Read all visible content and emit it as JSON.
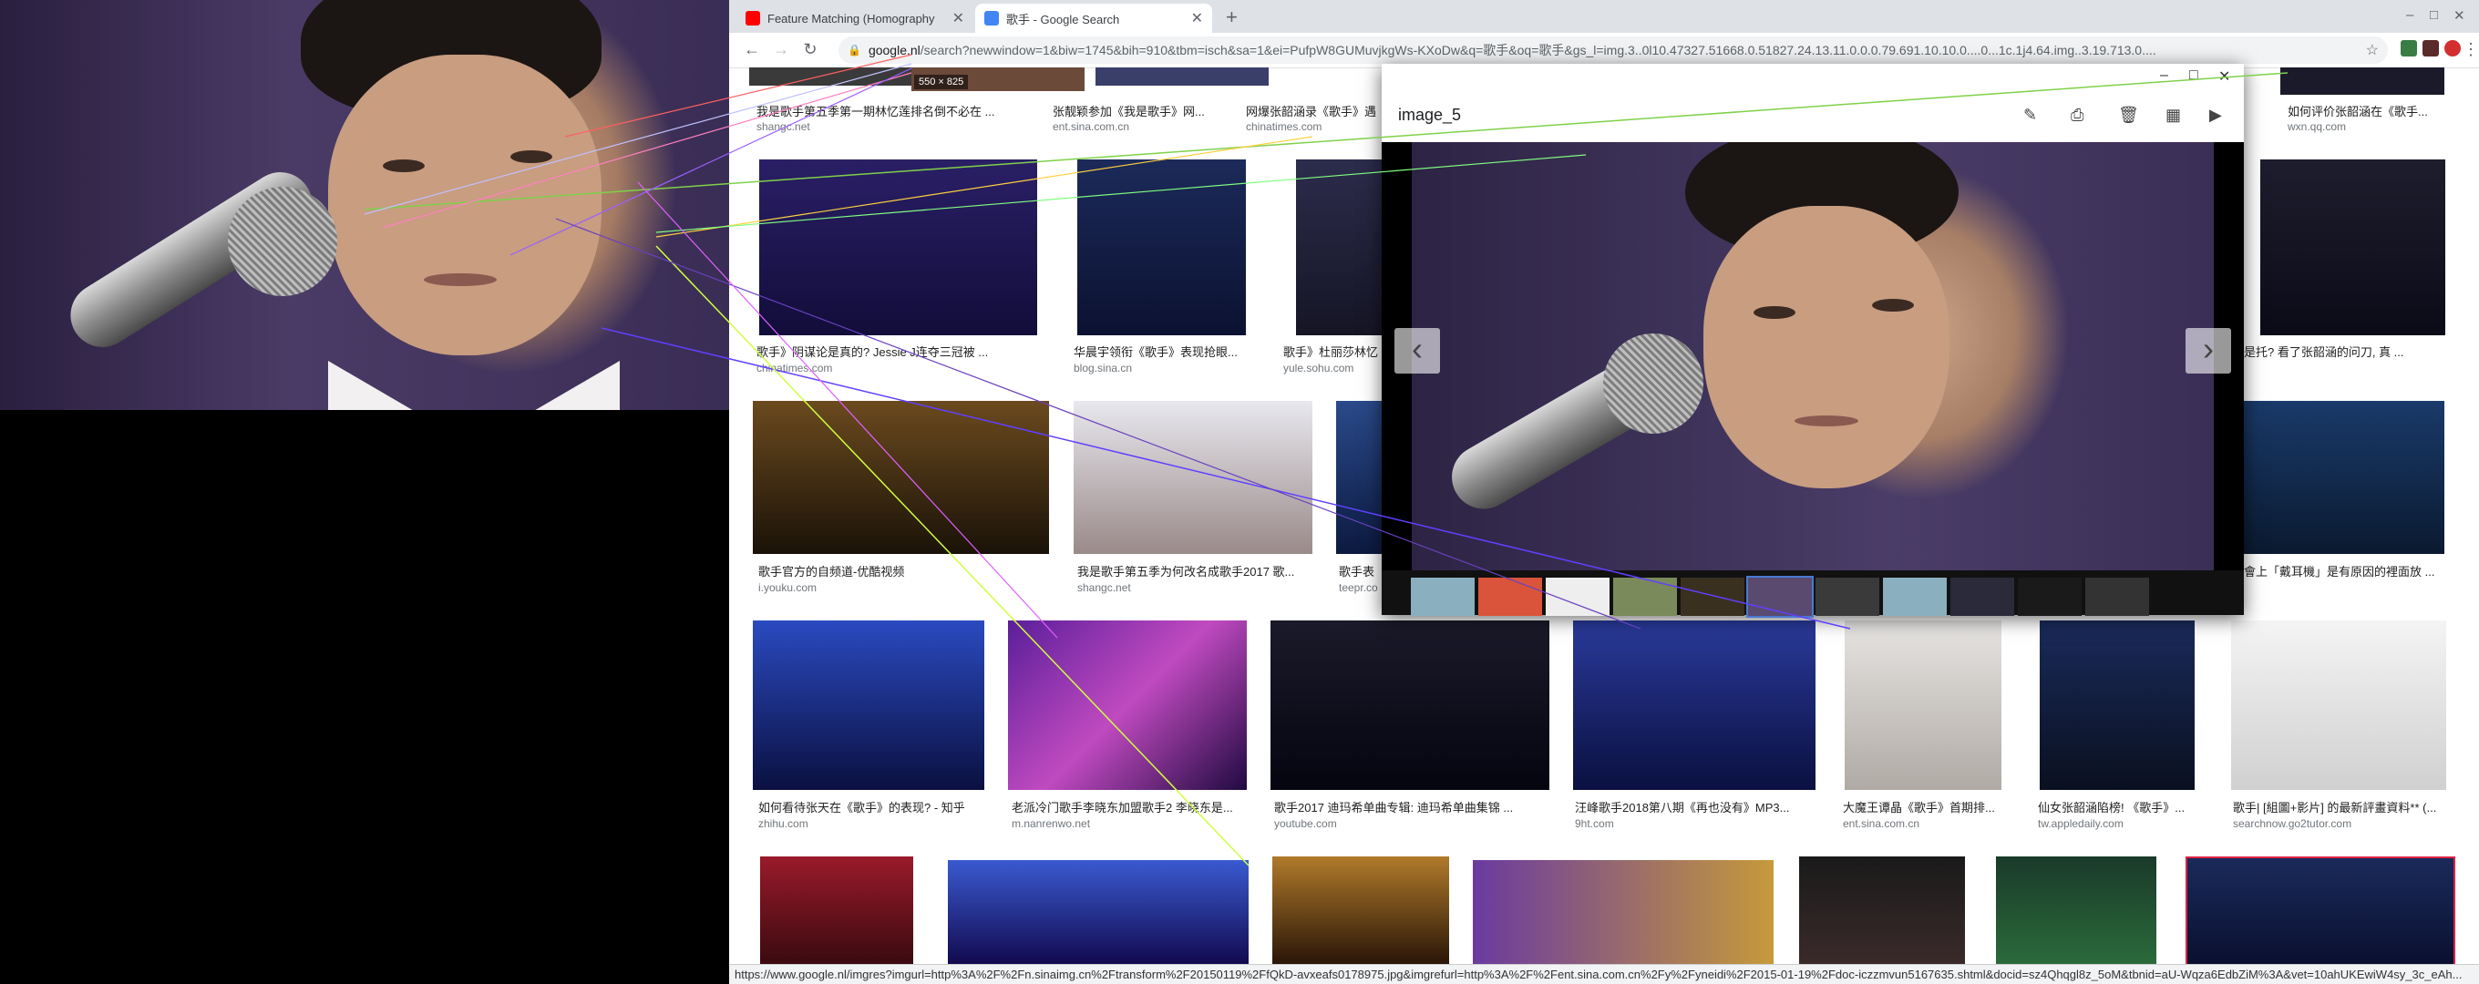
{
  "tabs": [
    {
      "title": "Feature Matching (Homography",
      "favicon_color": "#ff0000"
    },
    {
      "title": "歌手 - Google Search",
      "favicon_color": "#4285f4"
    }
  ],
  "toolbar": {
    "url_host": "google.nl",
    "url_rest": "/search?newwindow=1&biw=1745&bih=910&tbm=isch&sa=1&ei=PufpW8GUMuvjkgWs-KXoDw&q=歌手&oq=歌手&gs_l=img.3..0l10.47327.51668.0.51827.24.13.11.0.0.0.79.691.10.10.0....0...1c.1j4.64.img..3.19.713.0...."
  },
  "results": {
    "row0": [
      {
        "caption": "我是歌手第五季第一期林忆莲排名倒不必在 ...",
        "source": "shangc.net"
      },
      {
        "caption": "张靓颖参加《我是歌手》网...",
        "source": "ent.sina.com.cn",
        "dims": "550 × 825"
      },
      {
        "caption": "网爆张韶涵录《歌手》遇",
        "source": "chinatimes.com"
      },
      {
        "caption": "如何评价张韶涵在《歌手...",
        "source": "wxn.qq.com"
      }
    ],
    "row1": [
      {
        "caption": "歌手》阴谋论是真的? Jessie J连夺三冠被 ...",
        "source": "chinatimes.com"
      },
      {
        "caption": "华晨宇领衔《歌手》表现抢眼...",
        "source": "blog.sina.cn"
      },
      {
        "caption": "歌手》杜丽莎林忆",
        "source": "yule.sohu.com"
      },
      {
        "caption": "是托? 看了张韶涵的问刀, 真 ...",
        "source": ""
      }
    ],
    "row2": [
      {
        "caption": "歌手官方的自频道-优酷视频",
        "source": "i.youku.com"
      },
      {
        "caption": "我是歌手第五季为何改名成歌手2017 歌...",
        "source": "shangc.net"
      },
      {
        "caption": "歌手表",
        "source": "teepr.co"
      },
      {
        "caption": "會上「戴耳機」是有原因的裡面放 ...",
        "source": ""
      }
    ],
    "row3": [
      {
        "caption": "如何看待张天在《歌手》的表现? - 知乎",
        "source": "zhihu.com"
      },
      {
        "caption": "老派冷门歌手李晓东加盟歌手2 李晓东是...",
        "source": "m.nanrenwo.net"
      },
      {
        "caption": "歌手2017 迪玛希单曲专辑: 迪玛希单曲集锦 ...",
        "source": "youtube.com"
      },
      {
        "caption": "汪峰歌手2018第八期《再也没有》MP3...",
        "source": "9ht.com"
      },
      {
        "caption": "大魔王谭晶《歌手》首期排...",
        "source": "ent.sina.com.cn"
      },
      {
        "caption": "仙女张韶涵陷榜! 《歌手》...",
        "source": "tw.appledaily.com"
      },
      {
        "caption": "歌手| [組圖+影片] 的最新評畫資料** (...",
        "source": "searchnow.go2tutor.com"
      }
    ]
  },
  "viewer": {
    "name": "image_5",
    "controls": [
      "–",
      "□",
      "✕"
    ],
    "tools": [
      "pencil-icon",
      "print-icon",
      "trash-icon",
      "grid-icon",
      "slideshow-icon"
    ],
    "prev": "‹",
    "next": "›"
  },
  "statusbar": "https://www.google.nl/imgres?imgurl=http%3A%2F%2Fn.sinaimg.cn%2Ftransform%2F20150119%2FfQkD-avxeafs0178975.jpg&imgrefurl=http%3A%2F%2Fent.sina.com.cn%2Fy%2Fyneidi%2F2015-01-19%2Fdoc-iczzmvun5167635.shtml&docid=sz4Qhqgl8z_5oM&tbnid=aU-Wqza6EdbZiM%3A&vet=10ahUKEwiW4sy_3c_eAh..."
}
